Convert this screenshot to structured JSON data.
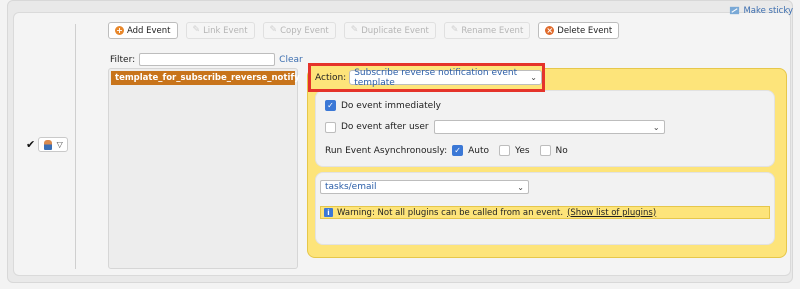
{
  "sticky": {
    "label": "Make sticky",
    "icon": "pin-icon"
  },
  "toolbar": {
    "add": "Add Event",
    "link": "Link Event",
    "copy": "Copy Event",
    "duplicate": "Duplicate Event",
    "rename": "Rename Event",
    "delete": "Delete Event"
  },
  "filter": {
    "label": "Filter:",
    "value": "",
    "clear": "Clear"
  },
  "events": [
    "template_for_subscribe_reverse_notify"
  ],
  "action": {
    "label": "Action:",
    "value": "Subscribe reverse notification event template"
  },
  "options": {
    "immediately": "Do event immediately",
    "after_user": "Do event after user",
    "after_user_value": "",
    "async_label": "Run Event Asynchronously:",
    "auto": "Auto",
    "yes": "Yes",
    "no": "No"
  },
  "plugin": {
    "value": "tasks/email"
  },
  "warning": {
    "text": "Warning: Not all plugins can be called from an event.",
    "link": "(Show list of plugins)"
  },
  "colors": {
    "selected_event": "#c8741b",
    "panel_yellow": "#fde47a",
    "highlight": "#e5332a",
    "link": "#3d6fb0"
  }
}
